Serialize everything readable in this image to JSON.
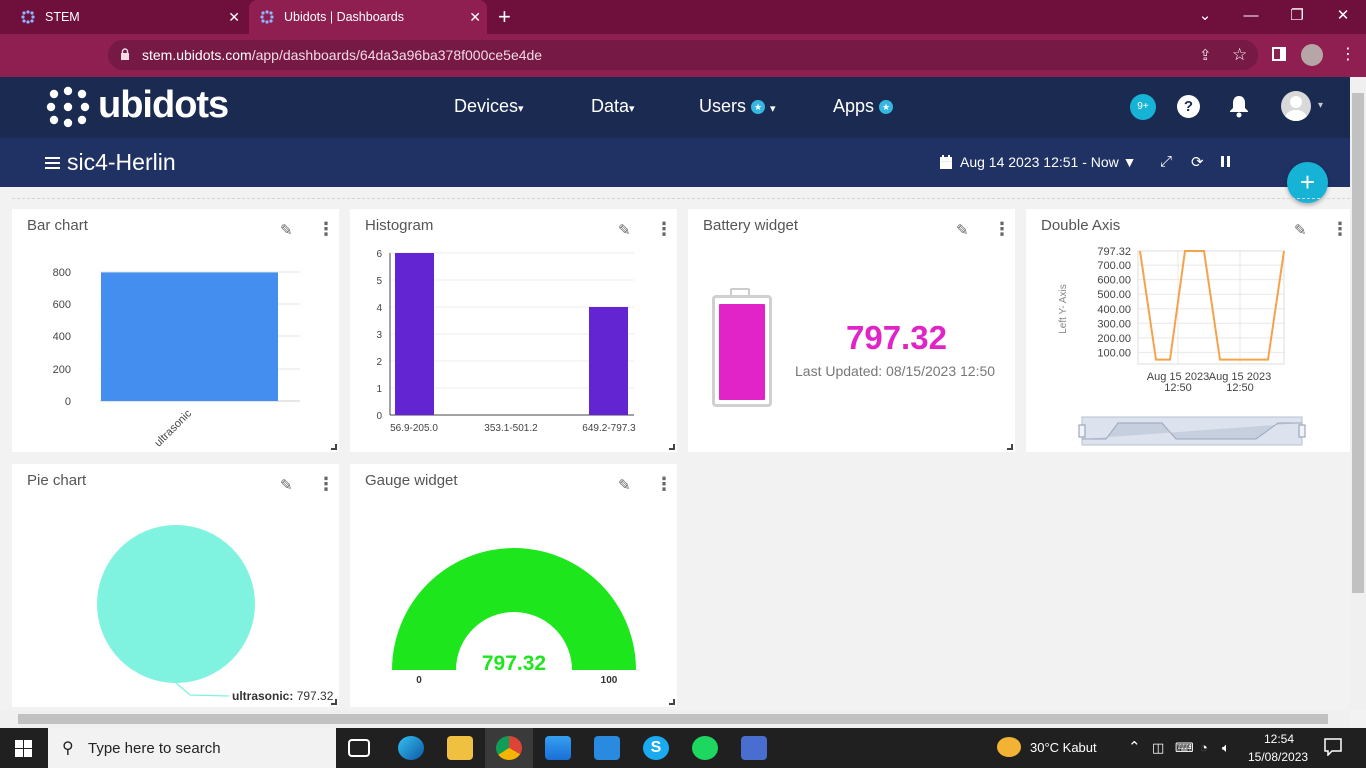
{
  "browser": {
    "tabs": [
      {
        "title": "STEM"
      },
      {
        "title": "Ubidots | Dashboards"
      }
    ],
    "url_host": "stem.ubidots.com",
    "url_path": "/app/dashboards/64da3a96ba378f000ce5e4de"
  },
  "header": {
    "logo": "ubidots",
    "menu": {
      "devices": "Devices",
      "data": "Data",
      "users": "Users",
      "apps": "Apps"
    },
    "notif_badge": "9+",
    "help": "?"
  },
  "dashboard": {
    "name": "sic4-Herlin",
    "date_range": "Aug 14 2023 12:51 - Now",
    "add": "+"
  },
  "widgets": {
    "bar": {
      "title": "Bar chart",
      "yticks": [
        "800",
        "600",
        "400",
        "200",
        "0"
      ],
      "xlabel": "ultrasonic"
    },
    "hist": {
      "title": "Histogram",
      "yticks": [
        "6",
        "5",
        "4",
        "3",
        "2",
        "1",
        "0"
      ],
      "xticks": [
        "56.9-205.0",
        "353.1-501.2",
        "649.2-797.3"
      ]
    },
    "battery": {
      "title": "Battery widget",
      "value": "797.32",
      "updated": "Last Updated: 08/15/2023 12:50"
    },
    "double": {
      "title": "Double Axis",
      "yticks": [
        "797.32",
        "700.00",
        "600.00",
        "500.00",
        "400.00",
        "300.00",
        "200.00",
        "100.00"
      ],
      "ylabel": "Left Y- Axis",
      "xtick1a": "Aug 15 2023",
      "xtick1b": "12:50",
      "xtick2a": "Aug 15 2023",
      "xtick2b": "12:50"
    },
    "pie": {
      "title": "Pie chart",
      "label_name": "ultrasonic:",
      "label_value": "797.32"
    },
    "gauge": {
      "title": "Gauge widget",
      "value": "797.32",
      "min": "0",
      "max": "100"
    }
  },
  "taskbar": {
    "search_placeholder": "Type here to search",
    "weather": "30°C  Kabut",
    "time": "12:54",
    "date": "15/08/2023"
  },
  "colors": {
    "bar": "#448ef0",
    "hist": "#6324d1",
    "battery": "#e024c8",
    "line": "#f5a24b",
    "pie": "#80f2e0",
    "gauge": "#1de61d"
  },
  "chart_data": [
    {
      "type": "bar",
      "categories": [
        "ultrasonic"
      ],
      "values": [
        797.32
      ],
      "ylim": [
        0,
        800
      ],
      "title": "Bar chart"
    },
    {
      "type": "bar",
      "categories": [
        "56.9-205.0",
        "353.1-501.2",
        "649.2-797.3"
      ],
      "values": [
        6,
        0,
        4
      ],
      "ylim": [
        0,
        6
      ],
      "title": "Histogram"
    },
    {
      "type": "line",
      "title": "Double Axis",
      "ylabel": "Left Y- Axis",
      "series": [
        {
          "values": [
            797.32,
            50,
            50,
            797.32,
            797.32,
            50,
            50,
            50,
            797.32
          ]
        }
      ]
    },
    {
      "type": "pie",
      "title": "Pie chart",
      "categories": [
        "ultrasonic"
      ],
      "values": [
        797.32
      ]
    }
  ]
}
